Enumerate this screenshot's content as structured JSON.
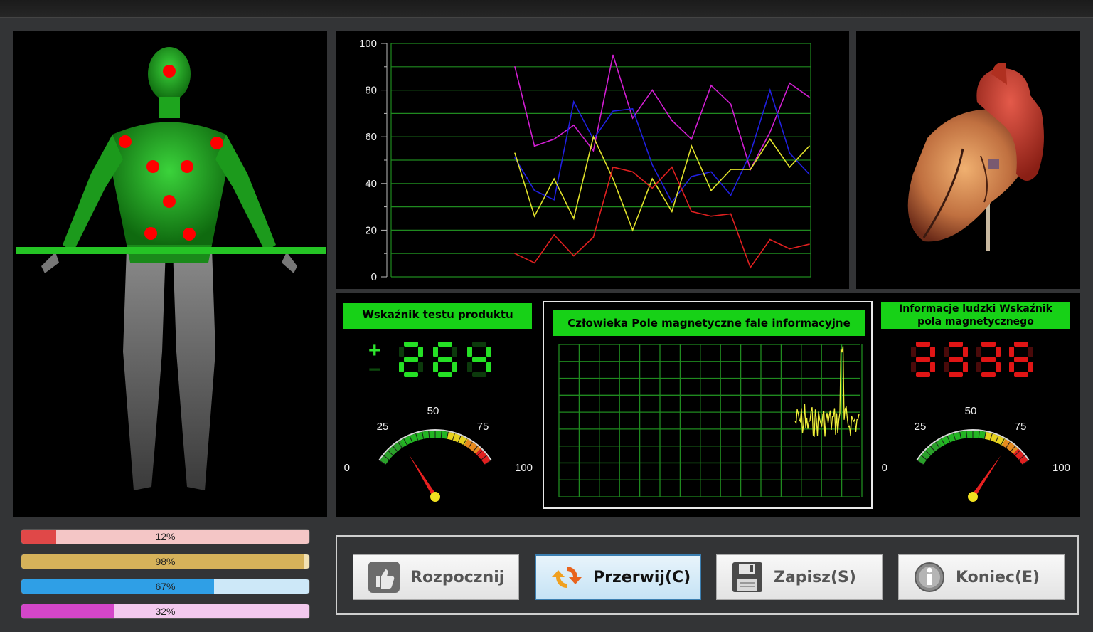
{
  "body_panel": {
    "points_color": "#ff0000",
    "progress_bars": [
      {
        "label": "12%",
        "value": 12,
        "fill": "#e04848",
        "track": "#f4c6c6"
      },
      {
        "label": "98%",
        "value": 98,
        "fill": "#d6b25a",
        "track": "#f2e1b3"
      },
      {
        "label": "67%",
        "value": 67,
        "fill": "#2f9fe6",
        "track": "#cde8f8"
      },
      {
        "label": "32%",
        "value": 32,
        "fill": "#d446c9",
        "track": "#f3c9ee"
      }
    ]
  },
  "chart_data": {
    "type": "line",
    "ylim": [
      0,
      100
    ],
    "yticks": [
      "0",
      "20",
      "40",
      "60",
      "80",
      "100"
    ],
    "grid": true,
    "grid_color": "#1f8a1f",
    "x": [
      0,
      1,
      2,
      3,
      4,
      5,
      6,
      7,
      8,
      9,
      10,
      11,
      12,
      13,
      14,
      15
    ],
    "series": [
      {
        "color": "#d21ed2",
        "values": [
          90,
          56,
          59,
          65,
          54,
          95,
          68,
          80,
          67,
          59,
          82,
          74,
          46,
          62,
          83,
          77
        ]
      },
      {
        "color": "#2020e0",
        "values": [
          51,
          37,
          33,
          75,
          59,
          71,
          72,
          48,
          32,
          43,
          45,
          35,
          53,
          80,
          53,
          44
        ]
      },
      {
        "color": "#e0e02a",
        "values": [
          53,
          26,
          42,
          25,
          60,
          42,
          20,
          42,
          28,
          56,
          37,
          46,
          46,
          59,
          47,
          56
        ]
      },
      {
        "color": "#e02020",
        "values": [
          10,
          6,
          18,
          9,
          17,
          47,
          45,
          38,
          47,
          28,
          26,
          27,
          4,
          16,
          12,
          14
        ]
      }
    ]
  },
  "product_test": {
    "title": "Wskaźnik testu produktu",
    "plus": "+",
    "minus": "−",
    "readout": "264",
    "gauge": {
      "labels": [
        "0",
        "25",
        "50",
        "75",
        "100"
      ],
      "value": 22
    }
  },
  "wave": {
    "title": "Człowieka Pole magnetyczne fale informacyjne",
    "trace_color": "#f0f03a"
  },
  "field_info": {
    "title_line1": "Informacje ludzki Wskaźnik",
    "title_line2": "pola magnetycznego",
    "readout": "3336",
    "gauge": {
      "labels": [
        "0",
        "25",
        "50",
        "75",
        "100"
      ],
      "value": 80
    }
  },
  "buttons": [
    {
      "label": "Rozpocznij",
      "icon": "thumbs-up-icon",
      "active": false
    },
    {
      "label": "Przerwij(C)",
      "icon": "refresh-icon",
      "active": true
    },
    {
      "label": "Zapisz(S)",
      "icon": "floppy-disk-icon",
      "active": false
    },
    {
      "label": "Koniec(E)",
      "icon": "info-icon",
      "active": false
    }
  ]
}
